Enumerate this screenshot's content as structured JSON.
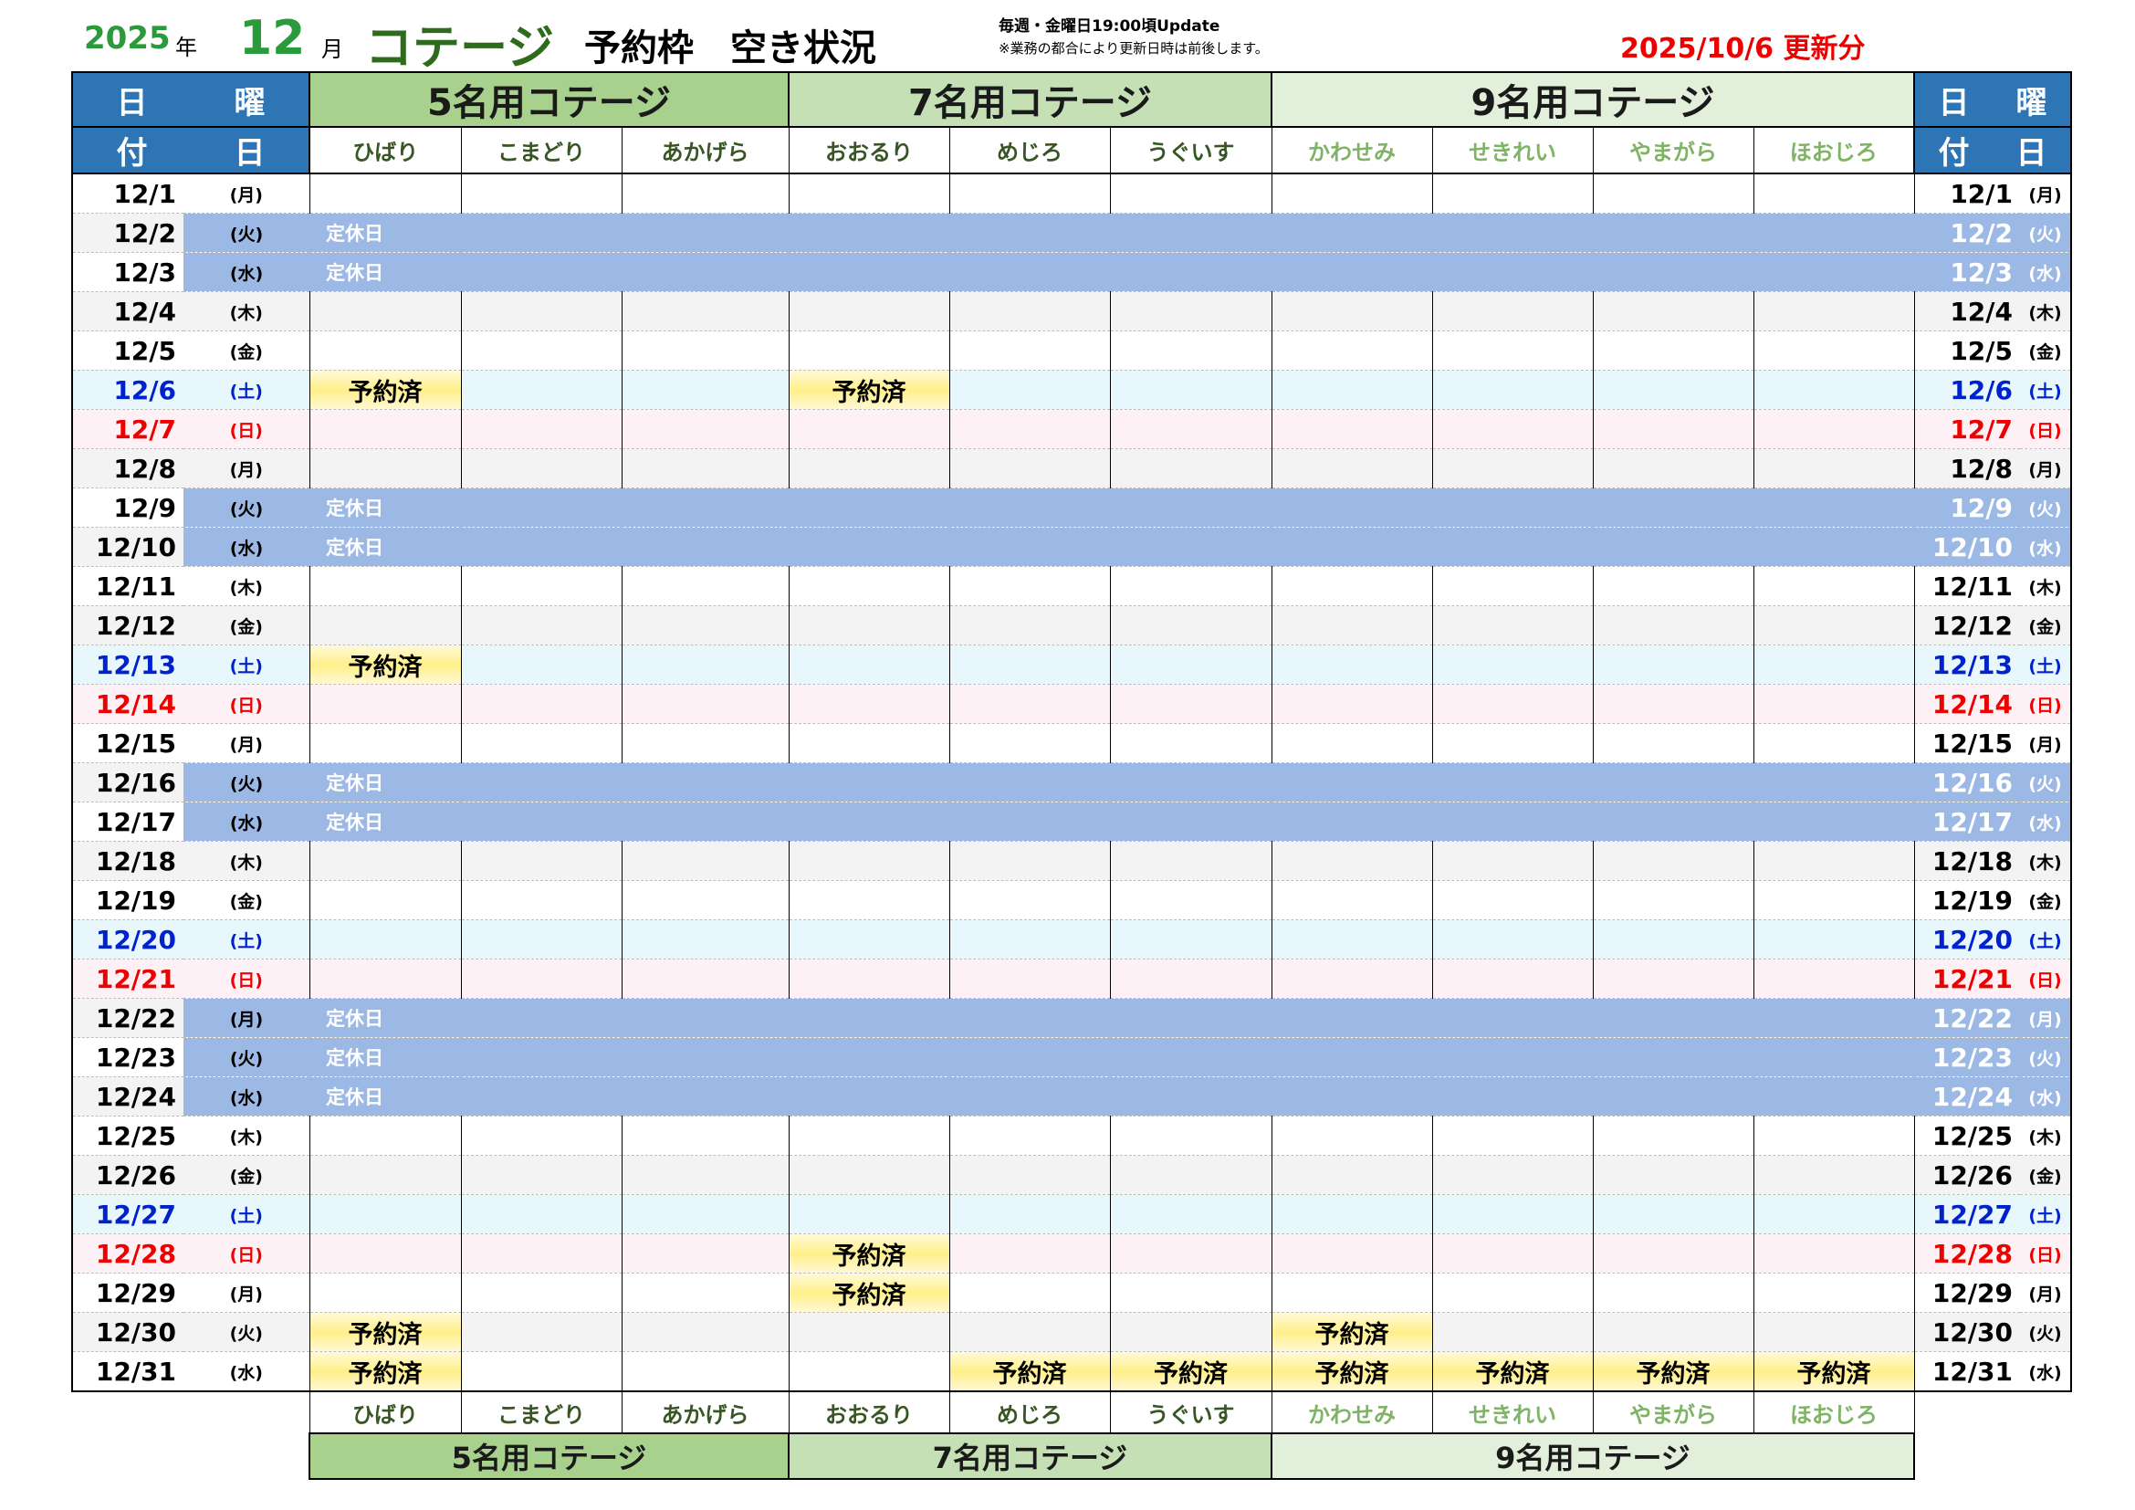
{
  "header": {
    "year": "2025",
    "year_unit": "年",
    "month": "12",
    "month_unit": "月",
    "title": "コテージ",
    "subtitle": "予約枠　空き状況",
    "note_update": "毎週・金曜日19:00頃Update",
    "note_disclaimer": "※業務の都合により更新日時は前後します。",
    "updated_label": "2025/10/6 更新分"
  },
  "date_header": {
    "top_left": "日",
    "top_right": "曜",
    "bottom_left": "付",
    "bottom_right": "日"
  },
  "groups": [
    {
      "name": "5名用コテージ",
      "cottages": [
        "ひばり",
        "こまどり",
        "あかげら"
      ]
    },
    {
      "name": "7名用コテージ",
      "cottages": [
        "おおるり",
        "めじろ",
        "うぐいす"
      ]
    },
    {
      "name": "9名用コテージ",
      "cottages": [
        "かわせみ",
        "せきれい",
        "やまがら",
        "ほおじろ"
      ]
    }
  ],
  "closed_label": "定休日",
  "booked_label": "予約済",
  "days": [
    {
      "date": "12/1",
      "wd": "月",
      "type": "normal",
      "booked": []
    },
    {
      "date": "12/2",
      "wd": "火",
      "type": "closed",
      "booked": []
    },
    {
      "date": "12/3",
      "wd": "水",
      "type": "closed",
      "booked": []
    },
    {
      "date": "12/4",
      "wd": "木",
      "type": "normal",
      "booked": []
    },
    {
      "date": "12/5",
      "wd": "金",
      "type": "normal",
      "booked": []
    },
    {
      "date": "12/6",
      "wd": "土",
      "type": "sat",
      "booked": [
        0,
        3
      ]
    },
    {
      "date": "12/7",
      "wd": "日",
      "type": "sun",
      "booked": []
    },
    {
      "date": "12/8",
      "wd": "月",
      "type": "normal",
      "booked": []
    },
    {
      "date": "12/9",
      "wd": "火",
      "type": "closed",
      "booked": []
    },
    {
      "date": "12/10",
      "wd": "水",
      "type": "closed",
      "booked": []
    },
    {
      "date": "12/11",
      "wd": "木",
      "type": "normal",
      "booked": []
    },
    {
      "date": "12/12",
      "wd": "金",
      "type": "normal",
      "booked": []
    },
    {
      "date": "12/13",
      "wd": "土",
      "type": "sat",
      "booked": [
        0
      ]
    },
    {
      "date": "12/14",
      "wd": "日",
      "type": "sun",
      "booked": []
    },
    {
      "date": "12/15",
      "wd": "月",
      "type": "normal",
      "booked": []
    },
    {
      "date": "12/16",
      "wd": "火",
      "type": "closed",
      "booked": []
    },
    {
      "date": "12/17",
      "wd": "水",
      "type": "closed",
      "booked": []
    },
    {
      "date": "12/18",
      "wd": "木",
      "type": "normal",
      "booked": []
    },
    {
      "date": "12/19",
      "wd": "金",
      "type": "normal",
      "booked": []
    },
    {
      "date": "12/20",
      "wd": "土",
      "type": "sat",
      "booked": []
    },
    {
      "date": "12/21",
      "wd": "日",
      "type": "sun",
      "booked": []
    },
    {
      "date": "12/22",
      "wd": "月",
      "type": "closed",
      "booked": []
    },
    {
      "date": "12/23",
      "wd": "火",
      "type": "closed",
      "booked": []
    },
    {
      "date": "12/24",
      "wd": "水",
      "type": "closed",
      "booked": []
    },
    {
      "date": "12/25",
      "wd": "木",
      "type": "normal",
      "booked": []
    },
    {
      "date": "12/26",
      "wd": "金",
      "type": "normal",
      "booked": []
    },
    {
      "date": "12/27",
      "wd": "土",
      "type": "sat",
      "booked": []
    },
    {
      "date": "12/28",
      "wd": "日",
      "type": "sun",
      "booked": [
        3
      ]
    },
    {
      "date": "12/29",
      "wd": "月",
      "type": "normal",
      "booked": [
        3
      ]
    },
    {
      "date": "12/30",
      "wd": "火",
      "type": "normal",
      "booked": [
        0,
        6
      ]
    },
    {
      "date": "12/31",
      "wd": "水",
      "type": "normal",
      "booked": [
        0,
        4,
        5,
        6,
        7,
        8,
        9
      ]
    }
  ]
}
